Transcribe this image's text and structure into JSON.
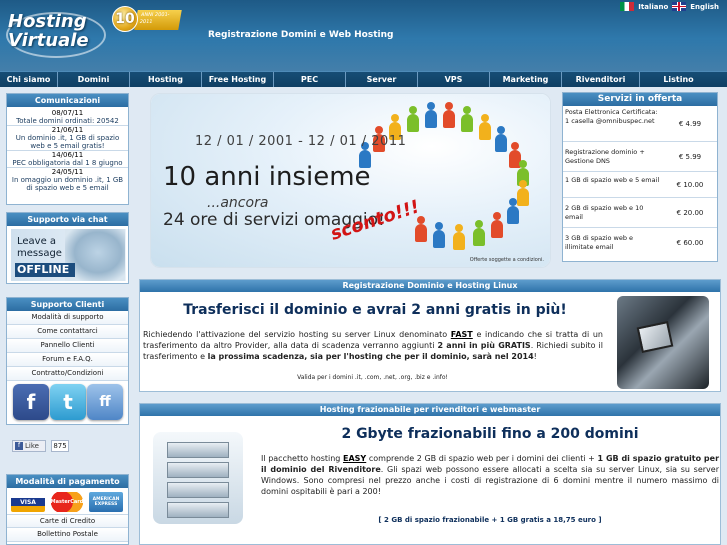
{
  "header": {
    "logo_line1": "Hosting",
    "logo_line2": "Virtuale",
    "badge_number": "10",
    "badge_ribbon": "ANNI 2001-2011",
    "title": "Registrazione Domini e Web Hosting",
    "lang_it": "Italiano",
    "lang_en": "English"
  },
  "nav": [
    "Chi siamo",
    "Domini",
    "Hosting",
    "Free Hosting",
    "PEC",
    "Server",
    "VPS",
    "Marketing",
    "Rivenditori",
    "Listino"
  ],
  "communications": {
    "title": "Comunicazioni",
    "items": [
      {
        "date": "08/07/11",
        "text": "Totale domini ordinati: 20542"
      },
      {
        "date": "21/06/11",
        "text": "Un dominio .it, 1 GB di spazio web e 5 email gratis!"
      },
      {
        "date": "14/06/11",
        "text": "PEC obbligatoria dal 1 8 giugno"
      },
      {
        "date": "24/05/11",
        "text": "In omaggio un dominio .it, 1 GB di spazio web e 5 email"
      }
    ]
  },
  "chat": {
    "title": "Supporto via chat",
    "leave": "Leave a",
    "message": "message",
    "status": "OFFLINE"
  },
  "support": {
    "title": "Supporto Clienti",
    "items": [
      "Modalità di supporto",
      "Come contattarci",
      "Pannello Clienti",
      "Forum e F.A.Q.",
      "Contratto/Condizioni"
    ]
  },
  "social": {
    "facebook": "f",
    "twitter": "t",
    "friendfeed": "ff",
    "like_label": "Like",
    "like_count": "875"
  },
  "payment": {
    "title": "Modalità di pagamento",
    "cards": [
      "VISA",
      "MasterCard",
      "AMERICAN EXPRESS"
    ],
    "items": [
      "Carte di Credito",
      "Bollettino Postale"
    ]
  },
  "banner": {
    "dates": "12 / 01 / 2001 - 12 / 01 / 2011",
    "title": "10 anni insieme",
    "sub1": "...ancora",
    "sub2": "24 ore di servizi omaggio!",
    "sconto": "sconto!!!",
    "note": "Offerte soggette a condizioni."
  },
  "offers": {
    "title": "Servizi in offerta",
    "rows": [
      {
        "desc": "Posta Elettronica Certificata: 1 casella @omnibuspec.net",
        "price": "€ 4.99"
      },
      {
        "desc": "Registrazione dominio + Gestione DNS",
        "price": "€ 5.99"
      },
      {
        "desc": "1 GB di spazio web e 5 email",
        "price": "€ 10.00"
      },
      {
        "desc": "2 GB di spazio web e 10 email",
        "price": "€ 20.00"
      },
      {
        "desc": "3 GB di spazio web e illimitate email",
        "price": "€ 60.00"
      }
    ]
  },
  "section1": {
    "head": "Registrazione Dominio e Hosting Linux",
    "title": "Trasferisci il dominio e avrai 2 anni gratis in più!",
    "p1": "Richiedendo l'attivazione del servizio hosting su server Linux denominato",
    "p1_link": "FAST",
    "p2": "e indicando che si tratta di un trasferimento da altro Provider, alla data di scadenza verranno aggiunti",
    "p2_bold": "2 anni in più GRATIS",
    "p3": ". Richiedi subito il trasferimento e",
    "p3_bold": "la prossima scadenza, sia per l'hosting che per il dominio, sarà nel 2014",
    "p3_end": "!",
    "note": "Valida per i domini .it, .com, .net, .org, .biz e .info!"
  },
  "section2": {
    "head": "Hosting frazionabile per rivenditori e webmaster",
    "title": "2 Gbyte frazionabili fino a 200 domini",
    "p1": "Il pacchetto hosting",
    "p1_link": "EASY",
    "p2": "comprende 2 GB di spazio web per i domini dei clienti +",
    "p2_bold": "1 GB di spazio gratuito per il dominio del Rivenditore",
    "p3": ". Gli spazi web possono essere allocati a scelta sia su server Linux, sia su server Windows. Sono compresi nel prezzo anche i costi di registrazione di 6 domini mentre il numero massimo di domini ospitabili è pari a 200!",
    "note": "[ 2 GB di spazio frazionabile + 1 GB gratis a 18,75 euro ]"
  }
}
